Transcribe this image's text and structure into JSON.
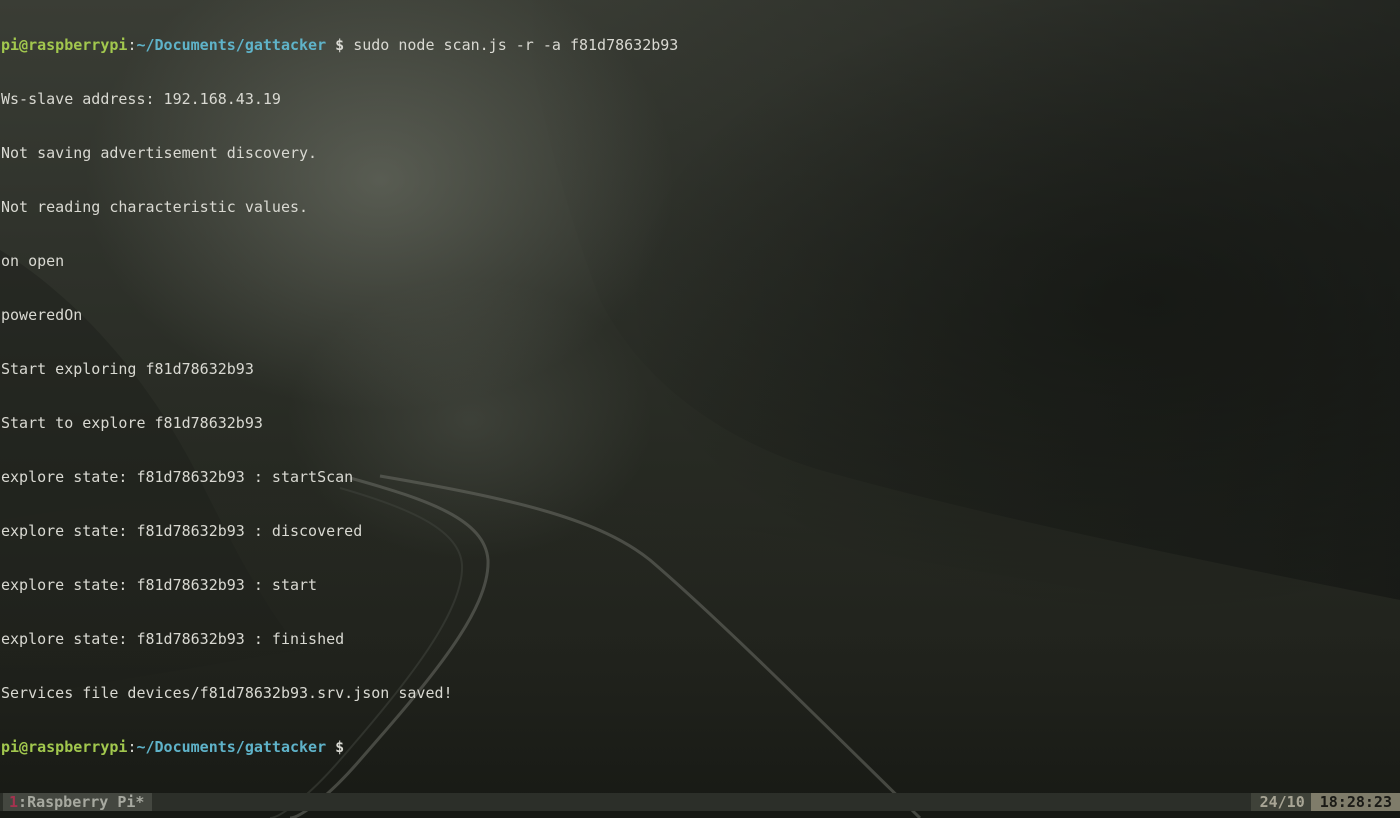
{
  "terminal": {
    "prompt": {
      "user_host": "pi@raspberrypi",
      "separator": ":",
      "path": "~/Documents/gattacker",
      "dollar": " $ "
    },
    "command": "sudo node scan.js -r -a f81d78632b93",
    "output": [
      "Ws-slave address: 192.168.43.19",
      "Not saving advertisement discovery.",
      "Not reading characteristic values.",
      "on open",
      "poweredOn",
      "Start exploring f81d78632b93",
      "Start to explore f81d78632b93",
      "explore state: f81d78632b93 : startScan",
      "explore state: f81d78632b93 : discovered",
      "explore state: f81d78632b93 : start",
      "explore state: f81d78632b93 : finished",
      "Services file devices/f81d78632b93.srv.json saved!"
    ]
  },
  "statusbar": {
    "window_index": "1",
    "window_sep": ":",
    "window_name": "Raspberry Pi*",
    "load": "24/10",
    "clock": "18:28:23"
  },
  "colors": {
    "prompt_user": "#a2c84e",
    "prompt_path": "#5fb3c9",
    "window_index": "#a4324f",
    "clock_bg": "#7f7c6a"
  }
}
